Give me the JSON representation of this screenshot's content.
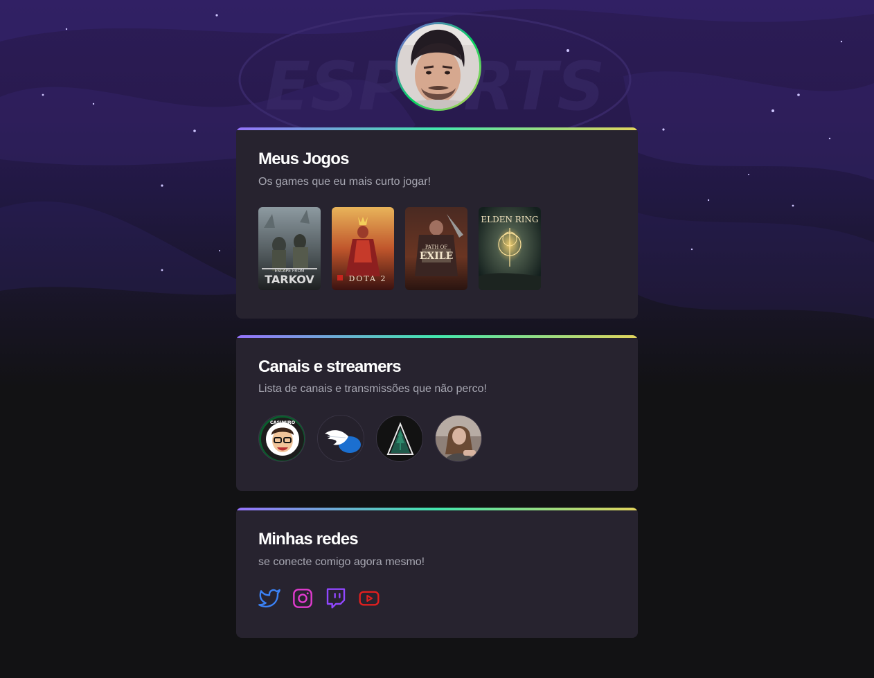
{
  "profile": {
    "avatar_alt": "Foto de perfil"
  },
  "background": {
    "logo_text": "ESPORTS"
  },
  "games_card": {
    "title": "Meus Jogos",
    "subtitle": "Os games que eu mais curto jogar!",
    "games": [
      {
        "name": "ESCAPE FROM TARKOV",
        "label_top": "ESCAPE FROM",
        "label_bottom": "TARKOV"
      },
      {
        "name": "DOTA 2",
        "label_top": "",
        "label_bottom": "DOTA 2"
      },
      {
        "name": "PATH OF EXILE",
        "label_top": "PATH OF",
        "label_bottom": "EXILE"
      },
      {
        "name": "ELDEN RING",
        "label_top": "ELDEN RING",
        "label_bottom": ""
      }
    ]
  },
  "streamers_card": {
    "title": "Canais e streamers",
    "subtitle": "Lista de canais e transmissões que não perco!",
    "channels": [
      {
        "name": "Casimiro",
        "badge_text": "CASIMIRO"
      },
      {
        "name": "Hermes wing channel"
      },
      {
        "name": "Green pyramid channel"
      },
      {
        "name": "Long-haired streamer"
      }
    ]
  },
  "socials_card": {
    "title": "Minhas redes",
    "subtitle": "se conecte comigo agora mesmo!",
    "networks": [
      {
        "name": "Twitter",
        "icon": "twitter-icon",
        "color": "#3b82f6"
      },
      {
        "name": "Instagram",
        "icon": "instagram-icon",
        "color": "#e23bd0"
      },
      {
        "name": "Twitch",
        "icon": "twitch-icon",
        "color": "#9147ff"
      },
      {
        "name": "YouTube",
        "icon": "youtube-icon",
        "color": "#e01f1f"
      }
    ]
  },
  "colors": {
    "gradient_start": "#9572fc",
    "gradient_mid": "#43e7ad",
    "gradient_end": "#e2d45c",
    "card_bg": "#27232f",
    "page_bg": "#121214"
  }
}
